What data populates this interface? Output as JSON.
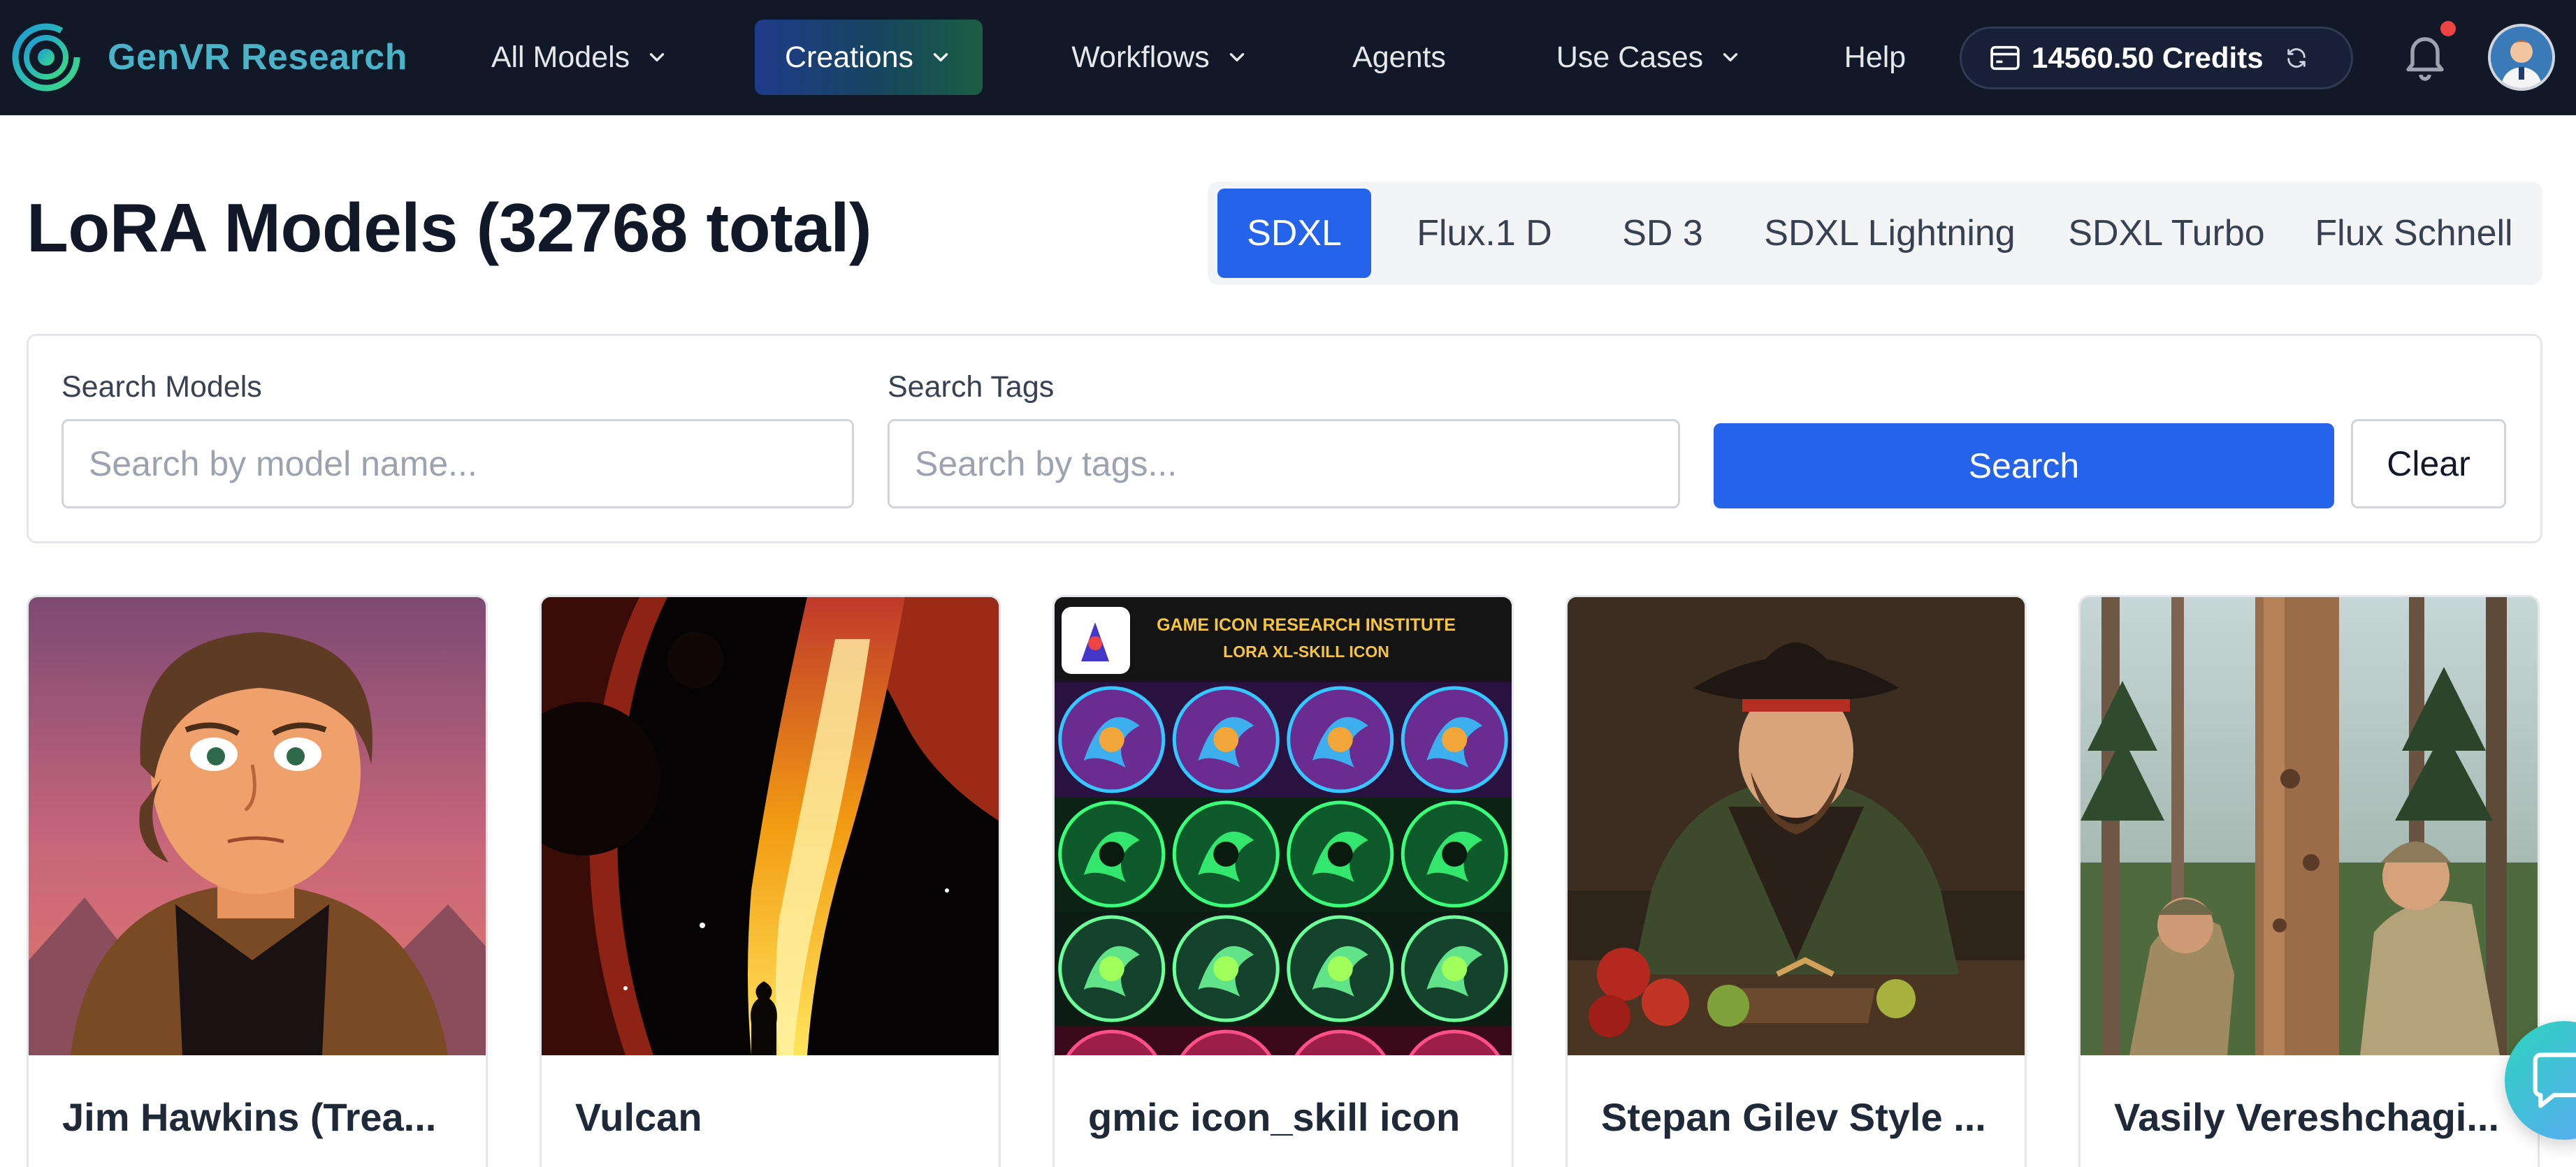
{
  "nav": {
    "brand": "GenVR Research",
    "items": [
      {
        "label": "All Models"
      },
      {
        "label": "Creations"
      },
      {
        "label": "Workflows"
      },
      {
        "label": "Agents"
      },
      {
        "label": "Use Cases"
      },
      {
        "label": "Help"
      }
    ],
    "active_item": "Creations",
    "credits": "14560.50 Credits",
    "notification_dot": true
  },
  "page": {
    "title": "LoRA Models (32768 total)"
  },
  "tabs": {
    "items": [
      {
        "label": "SDXL"
      },
      {
        "label": "Flux.1 D"
      },
      {
        "label": "SD 3"
      },
      {
        "label": "SDXL Lightning"
      },
      {
        "label": "SDXL Turbo"
      },
      {
        "label": "Flux Schnell"
      }
    ],
    "active": "SDXL"
  },
  "search": {
    "models_label": "Search Models",
    "models_placeholder": "Search by model name...",
    "models_value": "",
    "tags_label": "Search Tags",
    "tags_placeholder": "Search by tags...",
    "tags_value": "",
    "search_button": "Search",
    "clear_button": "Clear"
  },
  "models": [
    {
      "title": "Jim Hawkins (Trea..."
    },
    {
      "title": "Vulcan"
    },
    {
      "title": "gmic icon_skill icon",
      "image_header_line1": "GAME ICON RESEARCH INSTITUTE",
      "image_header_line2": "LORA XL-SKILL ICON"
    },
    {
      "title": "Stepan Gilev Style ..."
    },
    {
      "title": "Vasily Vereshchagi..."
    }
  ],
  "colors": {
    "nav_bg": "#111827",
    "brand": "#4bb3c8",
    "primary": "#2563eb",
    "notification": "#ef4444"
  },
  "icons": [
    "genvr-logo-icon",
    "chevron-down-icon",
    "credit-card-icon",
    "refresh-icon",
    "bell-icon",
    "chat-icon"
  ]
}
